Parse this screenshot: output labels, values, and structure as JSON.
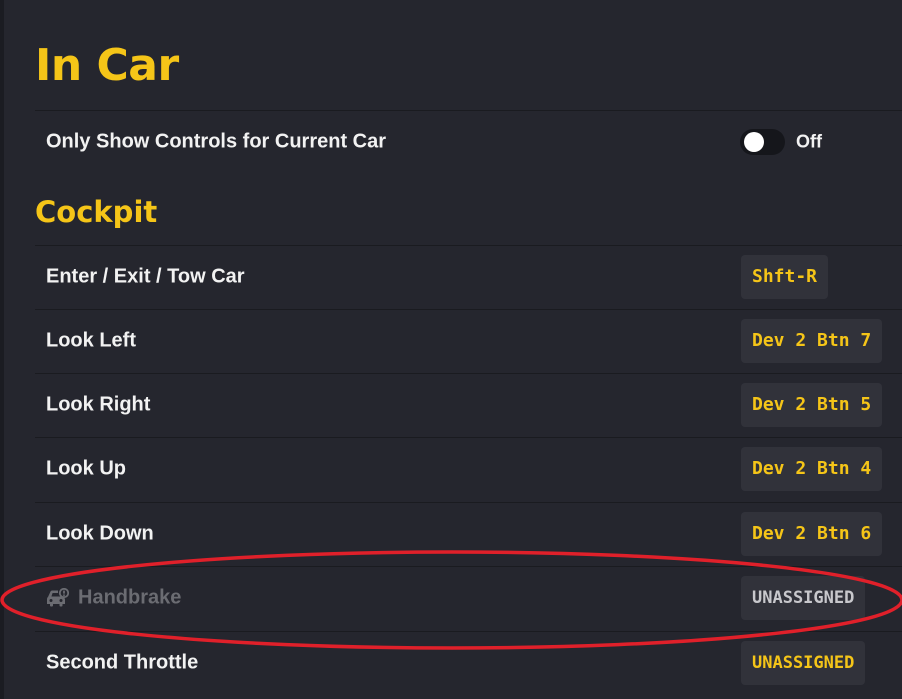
{
  "page": {
    "title": "In Car"
  },
  "general": {
    "only_show_current_car": {
      "label": "Only Show Controls for Current Car",
      "state_label": "Off",
      "enabled": false
    }
  },
  "cockpit": {
    "title": "Cockpit",
    "controls": [
      {
        "label": "Enter / Exit / Tow Car",
        "binding": "Shft-R"
      },
      {
        "label": "Look Left",
        "binding": "Dev 2 Btn 7"
      },
      {
        "label": "Look Right",
        "binding": "Dev 2 Btn 5"
      },
      {
        "label": "Look Up",
        "binding": "Dev 2 Btn 4"
      },
      {
        "label": "Look Down",
        "binding": "Dev 2 Btn 6"
      },
      {
        "label": "Handbrake",
        "binding": "UNASSIGNED",
        "disabled": true,
        "icon": "car-icon"
      },
      {
        "label": "Second Throttle",
        "binding": "UNASSIGNED"
      }
    ]
  },
  "colors": {
    "background": "#25262e",
    "accent": "#f5c518",
    "highlight": "#e0202a",
    "disabled_text": "#6b6c72"
  }
}
